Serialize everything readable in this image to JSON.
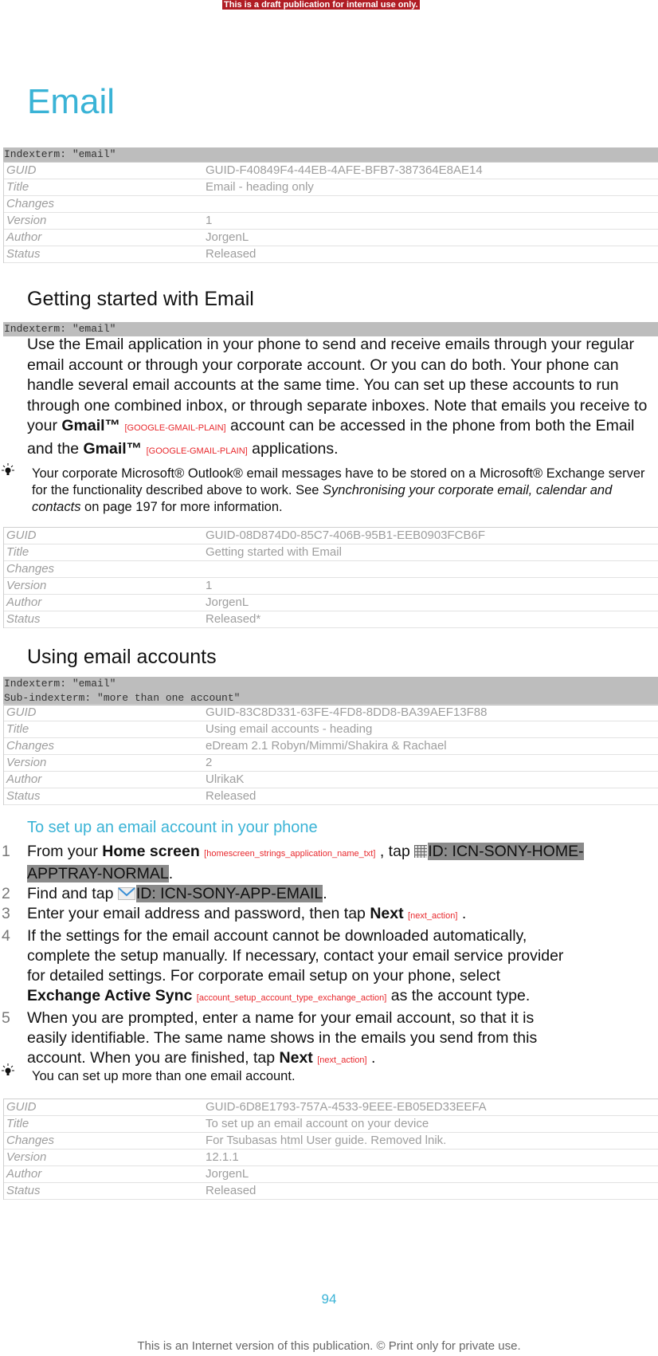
{
  "draft_banner": "This is a draft publication for internal use only.",
  "title": "Email",
  "section1": {
    "index_terms": [
      "Indexterm: \"email\""
    ],
    "meta": [
      {
        "key": "GUID",
        "value": "GUID-F40849F4-44EB-4AFE-BFB7-387364E8AE14"
      },
      {
        "key": "Title",
        "value": "Email - heading only"
      },
      {
        "key": "Changes",
        "value": ""
      },
      {
        "key": "Version",
        "value": "1"
      },
      {
        "key": "Author",
        "value": "JorgenL"
      },
      {
        "key": "Status",
        "value": "Released"
      }
    ]
  },
  "section2": {
    "heading": "Getting started with Email",
    "index_terms": [
      "Indexterm: \"email\""
    ],
    "body": {
      "part1": "Use the Email application in your phone to send and receive emails through your regular email account or through your corporate account. Or you can do both. Your phone can handle several email accounts at the same time. You can set up these accounts to run through one combined inbox, or through separate inboxes. Note that emails you receive to your ",
      "gmail1": "Gmail™",
      "tag1": "[GOOGLE-GMAIL-PLAIN]",
      "part2": " account can be accessed in the phone from both the Email and the ",
      "gmail2": "Gmail™",
      "tag2": "[GOOGLE-GMAIL-PLAIN]",
      "part3": " applications."
    },
    "tip": {
      "part1": "Your corporate Microsoft® Outlook® email messages have to be stored on a Microsoft® Exchange server for the functionality described above to work. See ",
      "link": "Synchronising your corporate email, calendar and contacts",
      "part2": " on page 197 for more information."
    },
    "meta": [
      {
        "key": "GUID",
        "value": "GUID-08D874D0-85C7-406B-95B1-EEB0903FCB6F"
      },
      {
        "key": "Title",
        "value": "Getting started with Email"
      },
      {
        "key": "Changes",
        "value": ""
      },
      {
        "key": "Version",
        "value": "1"
      },
      {
        "key": "Author",
        "value": "JorgenL"
      },
      {
        "key": "Status",
        "value": "Released*"
      }
    ]
  },
  "section3": {
    "heading": "Using email accounts",
    "index_terms": [
      "Indexterm: \"email\"",
      "Sub-indexterm: \"more than one account\""
    ],
    "meta": [
      {
        "key": "GUID",
        "value": "GUID-83C8D331-63FE-4FD8-8DD8-BA39AEF13F88"
      },
      {
        "key": "Title",
        "value": "Using email accounts - heading"
      },
      {
        "key": "Changes",
        "value": "eDream 2.1 Robyn/Mimmi/Shakira & Rachael"
      },
      {
        "key": "Version",
        "value": "2"
      },
      {
        "key": "Author",
        "value": "UlrikaK"
      },
      {
        "key": "Status",
        "value": "Released"
      }
    ]
  },
  "section4": {
    "heading": "To set up an email account in your phone",
    "steps": {
      "s1": {
        "num": "1",
        "a": "From your ",
        "b": "Home screen",
        "tag": "[homescreen_strings_application_name_txt]",
        "c": " , tap ",
        "id": "ID: ICN-SONY-HOME-APPTRAY-NORMAL",
        "d": "."
      },
      "s2": {
        "num": "2",
        "a": "Find and tap ",
        "id": "ID: ICN-SONY-APP-EMAIL",
        "d": "."
      },
      "s3": {
        "num": "3",
        "a": "Enter your email address and password, then tap ",
        "b": "Next",
        "tag": "[next_action]",
        "d": " ."
      },
      "s4": {
        "num": "4",
        "a": "If the settings for the email account cannot be downloaded automatically, complete the setup manually. If necessary, contact your email service provider for detailed settings. For corporate email setup on your phone, select ",
        "b": "Exchange Active Sync",
        "tag": "[account_setup_account_type_exchange_action]",
        "d": " as the account type."
      },
      "s5": {
        "num": "5",
        "a": "When you are prompted, enter a name for your email account, so that it is easily identifiable. The same name shows in the emails you send from this account. When you are finished, tap ",
        "b": "Next",
        "tag": "[next_action]",
        "d": " ."
      }
    },
    "tip": "You can set up more than one email account.",
    "meta": [
      {
        "key": "GUID",
        "value": "GUID-6D8E1793-757A-4533-9EEE-EB05ED33EEFA"
      },
      {
        "key": "Title",
        "value": "To set up an email account on your device"
      },
      {
        "key": "Changes",
        "value": "For Tsubasas html User guide. Removed lnik."
      },
      {
        "key": "Version",
        "value": "12.1.1"
      },
      {
        "key": "Author",
        "value": "JorgenL"
      },
      {
        "key": "Status",
        "value": "Released"
      }
    ]
  },
  "page_number": "94",
  "footer": "This is an Internet version of this publication. © Print only for private use."
}
